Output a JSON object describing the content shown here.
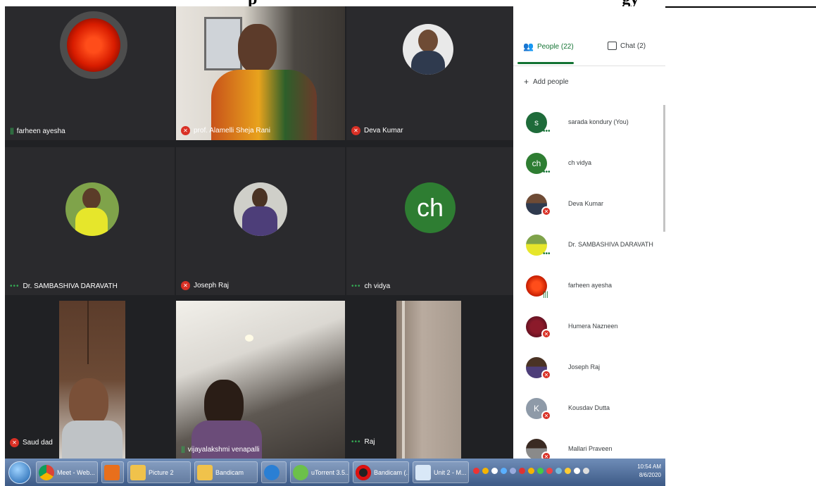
{
  "header": {
    "title_fragment": "p",
    "title_fragment_right": "gy"
  },
  "tiles": [
    {
      "name": "farheen ayesha",
      "mic": "on"
    },
    {
      "name": "prof. Alamelli Sheja Rani",
      "mic": "off"
    },
    {
      "name": "Deva Kumar",
      "mic": "off"
    },
    {
      "name": "Dr. SAMBASHIVA DARAVATH",
      "mic": "dots"
    },
    {
      "name": "Joseph Raj",
      "mic": "off"
    },
    {
      "name": "ch vidya",
      "mic": "dots",
      "initials": "ch"
    },
    {
      "name": "Saud dad",
      "mic": "off"
    },
    {
      "name": "vijayalakshmi venapalli",
      "mic": "on"
    },
    {
      "name": "Raj",
      "mic": "dots"
    }
  ],
  "panel": {
    "tab_people": "People (22)",
    "tab_chat": "Chat (2)",
    "add_people": "Add people",
    "people": [
      {
        "name": "sarada kondury (You)",
        "initials": "s",
        "badge": "dots"
      },
      {
        "name": "ch vidya",
        "initials": "ch",
        "badge": "dots"
      },
      {
        "name": "Deva Kumar",
        "initials": "",
        "badge": "muted"
      },
      {
        "name": "Dr. SAMBASHIVA DARAVATH",
        "initials": "",
        "badge": "dots"
      },
      {
        "name": "farheen ayesha",
        "initials": "",
        "badge": "mic"
      },
      {
        "name": "Humera Nazneen",
        "initials": "",
        "badge": "muted"
      },
      {
        "name": "Joseph Raj",
        "initials": "",
        "badge": "muted"
      },
      {
        "name": "Kousdav Dutta",
        "initials": "K",
        "badge": "muted"
      },
      {
        "name": "Mallari Praveen",
        "initials": "",
        "badge": "muted"
      }
    ]
  },
  "taskbar": {
    "items": [
      "Meet - Web...",
      "",
      "Picture 2",
      "Bandicam",
      "",
      "uTorrent 3.5...",
      "Bandicam (...",
      "Unit 2 - M..."
    ],
    "time": "10:54 AM",
    "date": "8/6/2020"
  },
  "colors": {
    "meet_green": "#137333",
    "muted_red": "#d93025",
    "tile_bg": "#202124"
  }
}
